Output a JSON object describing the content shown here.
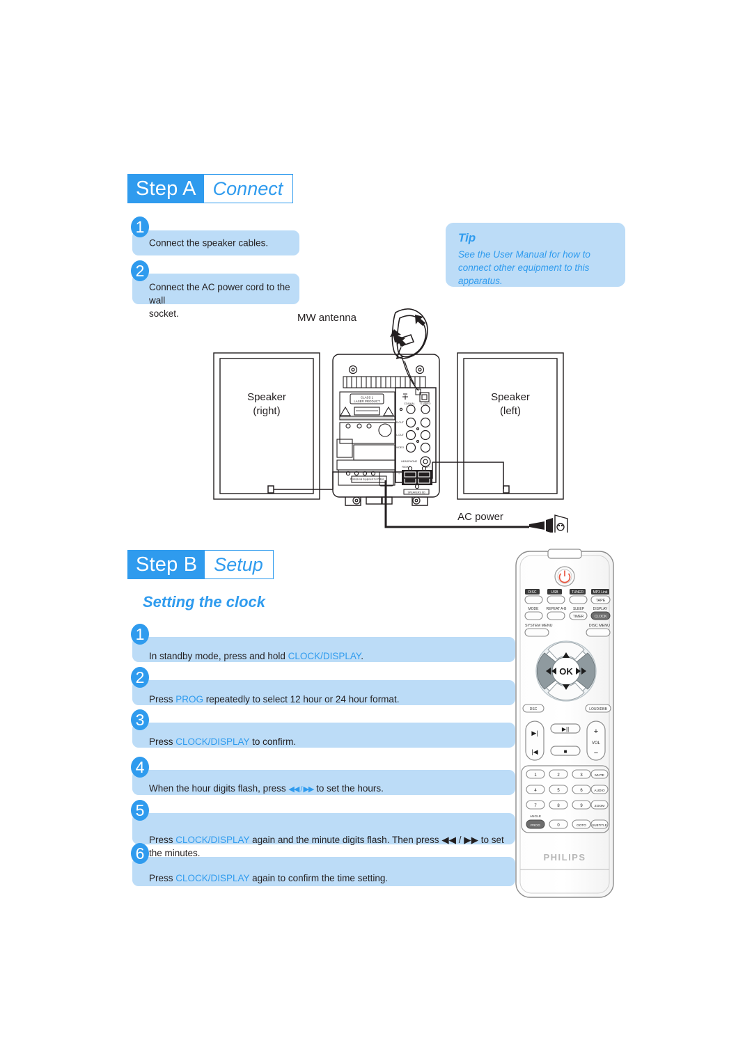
{
  "colors": {
    "accent": "#2f9bee",
    "bar": "#bcdcf7",
    "text": "#231f20",
    "power": "#e8553f"
  },
  "step_a": {
    "lead": "Step A",
    "tail": "Connect",
    "items": [
      {
        "num": "1",
        "text": "Connect the speaker cables."
      },
      {
        "num": "2",
        "text": "Connect the AC power cord to the wall\nsocket."
      }
    ]
  },
  "tip": {
    "title": "Tip",
    "body": "See the User Manual for how to connect other equipment to this apparatus."
  },
  "step_b": {
    "lead": "Step B",
    "tail": "Setup",
    "heading": "Setting the clock",
    "items": [
      {
        "num": "1",
        "pre": "In standby mode, press and hold ",
        "kw": "CLOCK/DISPLAY",
        "post": "."
      },
      {
        "num": "2",
        "pre": "Press ",
        "kw": "PROG",
        "post": " repeatedly to select 12 hour or 24 hour format."
      },
      {
        "num": "3",
        "pre": "Press ",
        "kw": "CLOCK/DISPLAY",
        "post": " to confirm."
      },
      {
        "num": "4",
        "pre": "When the hour digits flash, press ",
        "kw": "◀◀ / ▶▶",
        "post": " to set the hours."
      },
      {
        "num": "5",
        "pre": "Press ",
        "kw": "CLOCK/DISPLAY",
        "post": " again and the minute digits flash. Then press ◀◀ / ▶▶ to set the minutes."
      },
      {
        "num": "6",
        "pre": "Press ",
        "kw": "CLOCK/DISPLAY",
        "post": " again to confirm the time setting."
      }
    ]
  },
  "diagram": {
    "mw_antenna_label": "MW antenna",
    "speaker_right_line1": "Speaker",
    "speaker_right_line2": "(right)",
    "speaker_left_line1": "Speaker",
    "speaker_left_line2": "(left)",
    "ac_power_label": "AC power",
    "laser_label_line1": "CLASS 1",
    "laser_label_line2": "LASER PRODUCT",
    "panel_labels": {
      "fm_aerial": "FM AERIAL",
      "mw_aerial": "MW AERIAL",
      "coaxial": "COAXIAL",
      "s_video": "S-VIDEO",
      "r_out": "R-OUT",
      "l_out": "L-OUT",
      "video": "VIDEO",
      "headphone": "HEADPHONE",
      "right": "RIGHT",
      "left": "LEFT",
      "speakers": "SPEAKERS 6Ω",
      "plus": "+",
      "minus": "-"
    }
  },
  "remote": {
    "brand": "PHILIPS",
    "power_icon": "power-icon",
    "source_row": [
      {
        "label": "DISC",
        "name": "disc"
      },
      {
        "label": "USB",
        "name": "usb"
      },
      {
        "label": "TUNER",
        "name": "tuner"
      },
      {
        "label": "MP3 Link",
        "name": "mp3-link"
      }
    ],
    "tape_button": "TAPE",
    "function_row": [
      {
        "label": "MODE",
        "name": "mode"
      },
      {
        "label": "REPEAT A-B",
        "name": "repeat-ab"
      },
      {
        "label": "SLEEP",
        "name": "sleep"
      },
      {
        "label": "DISPLAY",
        "name": "display"
      }
    ],
    "timer_button": "TIMER",
    "clock_button": "CLOCK",
    "system_menu": "SYSTEM MENU",
    "disc_menu": "DISC MENU",
    "nav": {
      "ok": "OK",
      "up": "▲",
      "down": "▼",
      "left": "◀◀",
      "right": "▶▶"
    },
    "dsc_button": "DSC",
    "loud_dbb_button": "LOUD/DBB",
    "transport": {
      "next": "▶|",
      "prev": "|◀",
      "play_pause": "▶||",
      "stop": "■",
      "vol_up": "+",
      "vol_label": "VOL",
      "vol_down": "−"
    },
    "keypad": [
      [
        "1",
        "2",
        "3",
        "MUTE"
      ],
      [
        "4",
        "5",
        "6",
        "AUDIO"
      ],
      [
        "7",
        "8",
        "9",
        "ZOOM"
      ],
      [
        "PROG",
        "0",
        "GOTO",
        "SUBTITLE"
      ]
    ],
    "angle_label": "ANGLE"
  }
}
